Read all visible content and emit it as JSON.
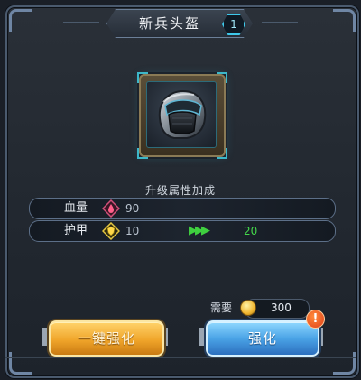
{
  "dialog": {
    "title": "新兵头盔",
    "level": "1",
    "section_title": "升级属性加成"
  },
  "stats": [
    {
      "label": "血量",
      "icon": "blood-gem-icon",
      "value": "90",
      "new_value": ""
    },
    {
      "label": "护甲",
      "icon": "armor-shield-icon",
      "value": "10",
      "arrows": "▶▶▶",
      "new_value": "20"
    }
  ],
  "cost": {
    "label": "需要",
    "icon": "gold-coin-icon",
    "value": "300"
  },
  "buttons": {
    "one_click_label": "一键强化",
    "enhance_label": "强化",
    "alert_mark": "!"
  },
  "colors": {
    "accent_cyan": "#3ec8ea",
    "gold_button": "#f0a52a",
    "blue_button": "#4aa3e6",
    "upgrade_green": "#44d84a",
    "alert_orange": "#e0401a"
  }
}
